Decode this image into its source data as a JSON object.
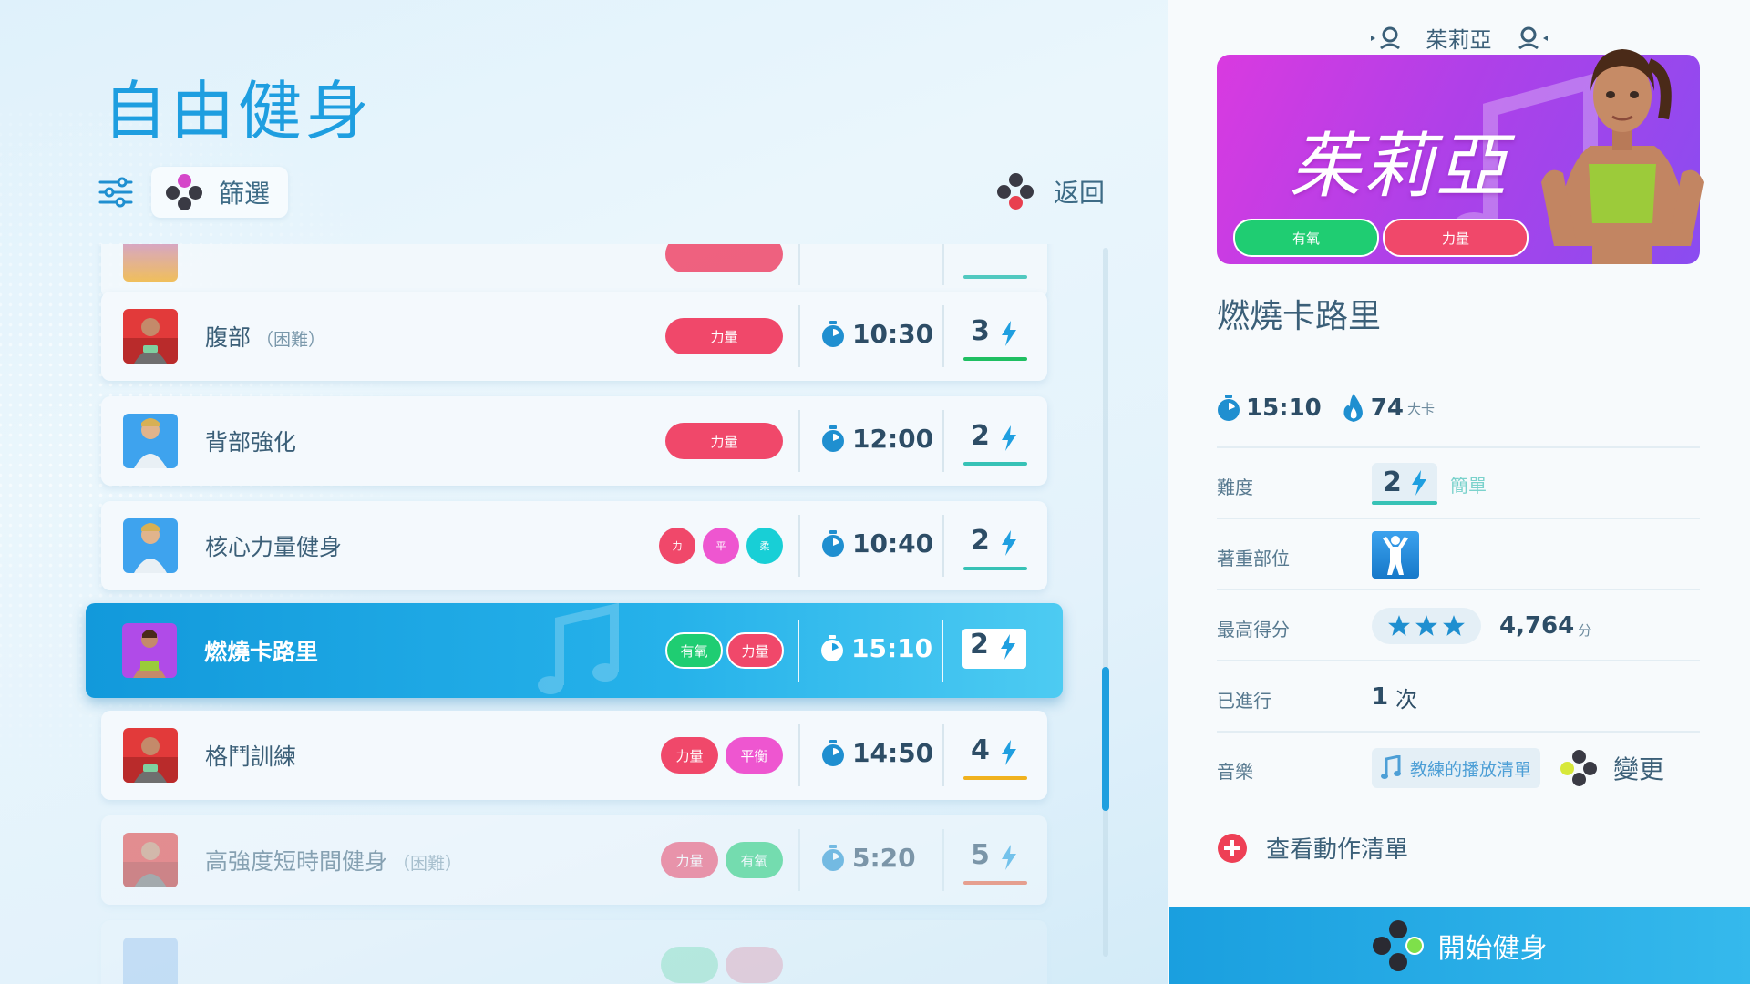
{
  "header": {
    "title": "自由健身",
    "filter_label": "篩選",
    "back_label": "返回"
  },
  "colors": {
    "accent": "#1e9ee0",
    "strength": "#f0486a",
    "cardio": "#1fcd72",
    "balance": "#ee56d0",
    "flexibility": "#18cfd6",
    "coach_card": "#b040e8"
  },
  "workouts": [
    {
      "name": "腹部",
      "suffix": "（困難）",
      "tags": [
        "力量"
      ],
      "duration": "10:30",
      "level": "3"
    },
    {
      "name": "背部強化",
      "suffix": "",
      "tags": [
        "力量"
      ],
      "duration": "12:00",
      "level": "2"
    },
    {
      "name": "核心力量健身",
      "suffix": "",
      "tags": [
        "力",
        "平",
        "柔"
      ],
      "duration": "10:40",
      "level": "2"
    },
    {
      "name": "燃燒卡路里",
      "suffix": "",
      "tags": [
        "有氧",
        "力量"
      ],
      "duration": "15:10",
      "level": "2",
      "selected": true
    },
    {
      "name": "格鬥訓練",
      "suffix": "",
      "tags": [
        "力量",
        "平衡"
      ],
      "duration": "14:50",
      "level": "4"
    },
    {
      "name": "高強度短時間健身",
      "suffix": "（困難）",
      "tags": [
        "力量",
        "有氧"
      ],
      "duration": "5:20",
      "level": "5"
    }
  ],
  "coach": {
    "name": "茱莉亞",
    "card_title": "茱莉亞",
    "card_tags": [
      "有氧",
      "力量"
    ]
  },
  "detail": {
    "title": "燃燒卡路里",
    "duration": "15:10",
    "calories": "74",
    "calories_unit": "大卡",
    "difficulty_label": "難度",
    "difficulty_value": "2",
    "difficulty_text": "簡單",
    "focus_label": "著重部位",
    "focus_icon": "full-body-icon",
    "best_score_label": "最高得分",
    "stars": 3,
    "best_score": "4,764",
    "best_score_unit": "分",
    "played_label": "已進行",
    "played_count": "1",
    "played_unit": "次",
    "music_label": "音樂",
    "music_value": "教練的播放清單",
    "change_label": "變更",
    "moves_label": "查看動作清單"
  },
  "start_button": "開始健身"
}
